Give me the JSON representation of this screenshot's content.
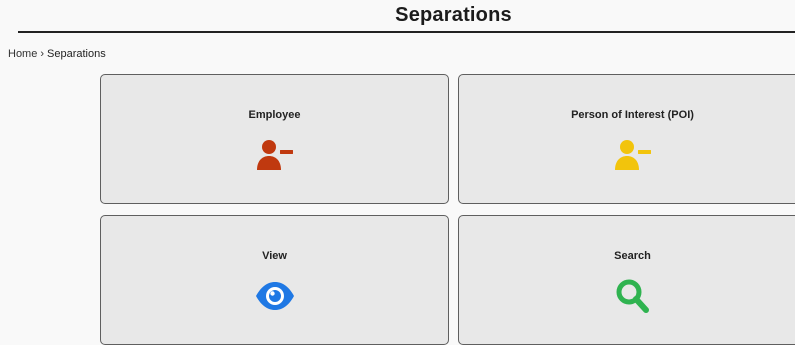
{
  "header": {
    "title": "Separations"
  },
  "breadcrumb": {
    "home": "Home",
    "separator": "›",
    "current": "Separations"
  },
  "tiles": [
    {
      "title": "Employee",
      "icon": "user-minus-icon",
      "color": "#c0390f"
    },
    {
      "title": "Person of Interest (POI)",
      "icon": "user-minus-icon",
      "color": "#f2c40c"
    },
    {
      "title": "View",
      "icon": "eye-icon",
      "color": "#1f78e4"
    },
    {
      "title": "Search",
      "icon": "search-icon",
      "color": "#2fb350"
    }
  ]
}
